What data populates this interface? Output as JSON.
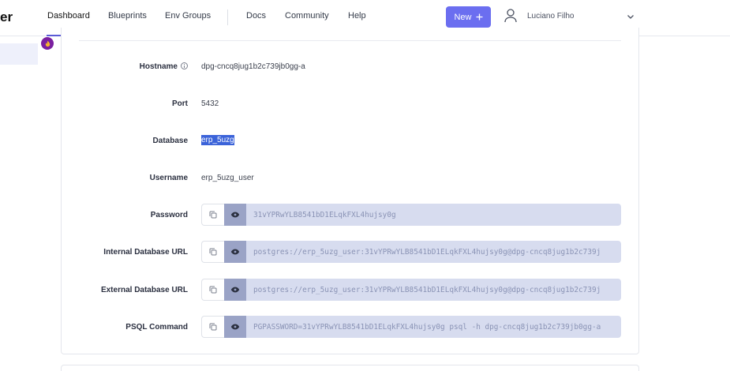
{
  "app": {
    "logo_fragment": "er"
  },
  "nav": {
    "links": [
      "Dashboard",
      "Blueprints",
      "Env Groups",
      "Docs",
      "Community",
      "Help"
    ],
    "new_button": "New",
    "user_name": "Luciano Filho"
  },
  "details": {
    "hostname": {
      "label": "Hostname",
      "value": "dpg-cncq8jug1b2c739jb0gg-a"
    },
    "port": {
      "label": "Port",
      "value": "5432"
    },
    "database": {
      "label": "Database",
      "value": "erp_5uzg"
    },
    "username": {
      "label": "Username",
      "value": "erp_5uzg_user"
    },
    "password": {
      "label": "Password",
      "value": "31vYPRwYLB8541bD1ELqkFXL4hujsy0g"
    },
    "internal_url": {
      "label": "Internal Database URL",
      "value": "postgres://erp_5uzg_user:31vYPRwYLB8541bD1ELqkFXL4hujsy0g@dpg-cncq8jug1b2c739j"
    },
    "external_url": {
      "label": "External Database URL",
      "value": "postgres://erp_5uzg_user:31vYPRwYLB8541bD1ELqkFXL4hujsy0g@dpg-cncq8jug1b2c739j"
    },
    "psql": {
      "label": "PSQL Command",
      "value": "PGPASSWORD=31vYPRwYLB8541bD1ELqkFXL4hujsy0g psql -h dpg-cncq8jug1b2c739jb0gg-a"
    }
  },
  "colors": {
    "accent": "#6b6ef0",
    "selection": "#3b63d9",
    "secret_bg": "#d7dcef"
  },
  "icons": [
    "plus-icon",
    "user-icon",
    "chevron-down-icon",
    "info-icon",
    "copy-icon",
    "eye-icon"
  ]
}
